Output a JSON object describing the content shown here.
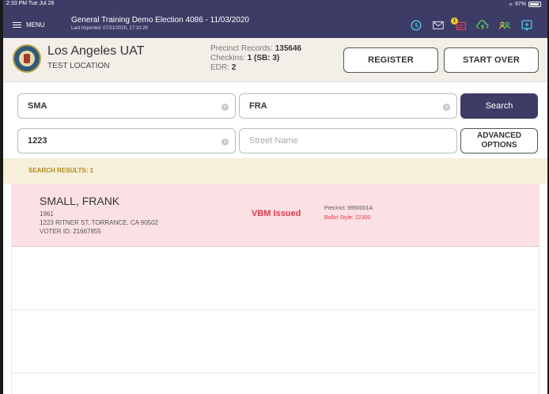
{
  "status_bar": {
    "time_date": "2:33 PM  Tue Jul 28",
    "battery": "97%"
  },
  "topbar": {
    "menu_label": "MENU",
    "title": "General Training  Demo Election 4086 - 11/03/2020",
    "last_imported": "Last Imported: 07/21/2020, 17:10:29",
    "notification_count": "1",
    "icons": [
      "history-icon",
      "mail-icon",
      "alert-document-icon",
      "cloud-upload-icon",
      "users-icon",
      "chat-icon"
    ]
  },
  "header": {
    "county": "Los Angeles UAT",
    "location": "TEST LOCATION",
    "precinct_records_label": "Precinct Records:",
    "precinct_records_value": "135646",
    "checkins_label": "Checkins:",
    "checkins_value": "1 (SB: 3)",
    "edr_label": "EDR:",
    "edr_value": "2",
    "register_label": "REGISTER",
    "start_over_label": "START OVER"
  },
  "search": {
    "last_name": "SMA",
    "first_name": "FRA",
    "house_number": "1223",
    "street_placeholder": "Street Name",
    "search_label": "Search",
    "advanced_line1": "ADVANCED",
    "advanced_line2": "OPTIONS"
  },
  "results": {
    "label": "SEARCH RESULTS: 1",
    "items": [
      {
        "name": "SMALL, FRANK",
        "year": "1961",
        "address": "1223 RITNER ST, TORRANCE, CA 90502",
        "voter_id": "VOTER ID: 21667855",
        "status": "VBM Issued",
        "precinct": "Precinct: 9950001A",
        "ballot_style": "Ballot Style: 22300"
      }
    ]
  },
  "colors": {
    "brand": "#3d3c66",
    "vbm_status": "#e2374d",
    "results_bar": "#f6efd9",
    "result_row": "#fbe1e4",
    "badge": "#f4d01c"
  }
}
